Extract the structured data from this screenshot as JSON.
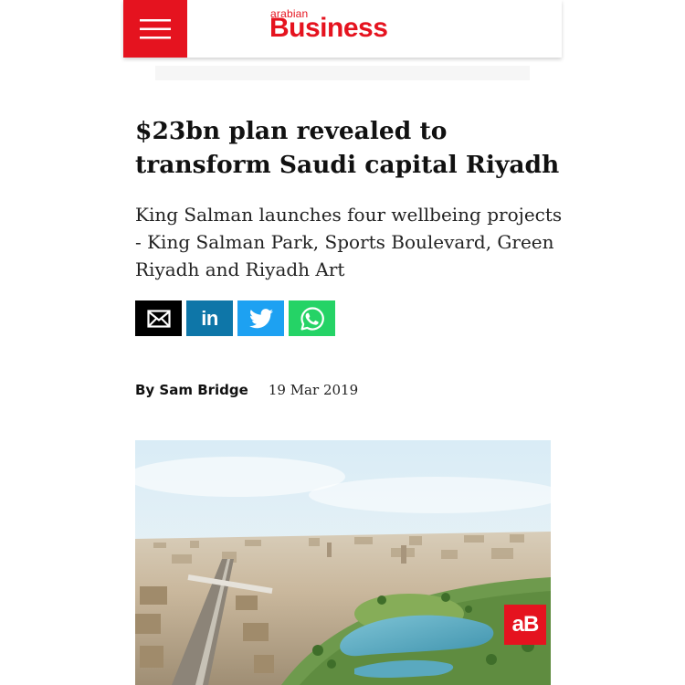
{
  "header": {
    "logo_small": "arabian",
    "logo_big": "Business",
    "menu_icon": "hamburger-icon",
    "accent_color": "#e5131f"
  },
  "article": {
    "headline": "$23bn plan revealed to transform Saudi capital Riyadh",
    "subheadline": "King Salman launches four wellbeing projects - King Salman Park, Sports Boulevard, Green Riyadh and Riyadh Art",
    "author": "By Sam Bridge",
    "date": "19 Mar 2019"
  },
  "share": [
    {
      "name": "email",
      "icon": "email-icon",
      "color": "#000000"
    },
    {
      "name": "linkedin",
      "icon": "linkedin-icon",
      "label": "in",
      "color": "#0e76a8"
    },
    {
      "name": "twitter",
      "icon": "twitter-icon",
      "color": "#1da1f2"
    },
    {
      "name": "whatsapp",
      "icon": "whatsapp-icon",
      "color": "#25d366"
    }
  ],
  "hero": {
    "badge": "aB"
  }
}
